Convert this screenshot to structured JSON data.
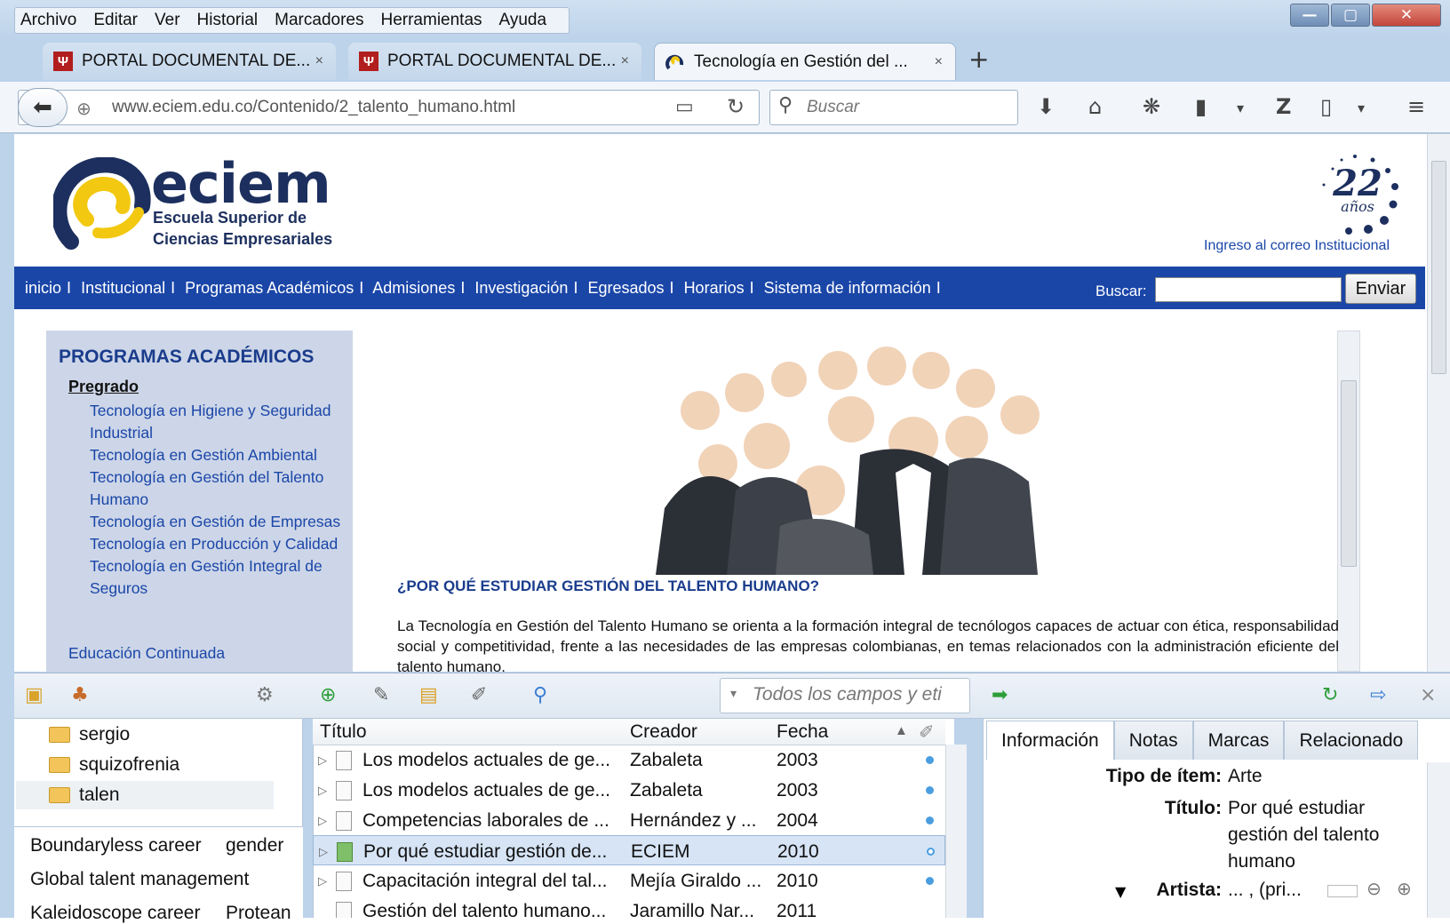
{
  "menubar": {
    "items": [
      "Archivo",
      "Editar",
      "Ver",
      "Historial",
      "Marcadores",
      "Herramientas",
      "Ayuda"
    ]
  },
  "window_buttons": {
    "minimize": "—",
    "maximize": "▢",
    "close": "✕"
  },
  "tabs": [
    {
      "label": "PORTAL DOCUMENTAL DE...",
      "favicon": "Ψ"
    },
    {
      "label": "PORTAL DOCUMENTAL DE...",
      "favicon": "Ψ"
    },
    {
      "label": "Tecnología en Gestión del ...",
      "favicon": "eciem"
    }
  ],
  "tab_close": "×",
  "new_tab": "+",
  "navbar": {
    "url": "www.eciem.edu.co/Contenido/2_talento_humano.html",
    "search_placeholder": "Buscar"
  },
  "site": {
    "logo_name": "eciem",
    "logo_line1": "Escuela  Superior  de",
    "logo_line2": "Ciencias  Empresariales",
    "badge_number": "22",
    "badge_text": "años",
    "correo_link": "Ingreso al correo Institucional",
    "nav": [
      "inicio",
      "Institucional",
      "Programas Académicos",
      "Admisiones",
      "Investigación",
      "Egresados",
      "Horarios",
      "Sistema de información"
    ],
    "nav_sep": "I",
    "search_label": "Buscar:",
    "search_button": "Enviar",
    "sidebar": {
      "heading": "PROGRAMAS ACADÉMICOS",
      "pregrado": "Pregrado",
      "programs": [
        "Tecnología en Higiene y Seguridad Industrial",
        "Tecnología en Gestión Ambiental",
        "Tecnología en Gestión del Talento Humano",
        "Tecnología en Gestión de Empresas",
        "Tecnología en Producción y Calidad",
        "Tecnología en Gestión Integral de Seguros"
      ],
      "continuing": "Educación Continuada"
    },
    "question": "¿POR QUÉ ESTUDIAR GESTIÓN DEL TALENTO HUMANO?",
    "body": "La Tecnología en Gestión del Talento Humano se orienta a la formación integral de tecnólogos capaces de actuar con ética, responsabilidad social y competitividad, frente a las necesidades de las empresas colombianas, en temas relacionados con la administración eficiente del talento humano."
  },
  "zotero": {
    "search_placeholder": "Todos los campos y eti",
    "collections": [
      "sergio",
      "squizofrenia",
      "talen"
    ],
    "tags": [
      [
        "Boundaryless career",
        "gender"
      ],
      [
        "Global talent management"
      ],
      [
        "Kaleidoscope career",
        "Protean"
      ]
    ],
    "columns": {
      "title": "Título",
      "creator": "Creador",
      "date": "Fecha"
    },
    "items": [
      {
        "title": "Los modelos actuales de ge...",
        "creator": "Zabaleta",
        "date": "2003"
      },
      {
        "title": "Los modelos actuales de ge...",
        "creator": "Zabaleta",
        "date": "2003"
      },
      {
        "title": "Competencias laborales de ...",
        "creator": "Hernández y ...",
        "date": "2004"
      },
      {
        "title": "Por qué estudiar gestión de...",
        "creator": "ECIEM",
        "date": "2010"
      },
      {
        "title": "Capacitación integral del tal...",
        "creator": "Mejía Giraldo ...",
        "date": "2010"
      },
      {
        "title": "Gestión del talento humano...",
        "creator": "Jaramillo Nar...",
        "date": "2011"
      }
    ],
    "selected_index": 3,
    "right_tabs": [
      "Información",
      "Notas",
      "Marcas",
      "Relacionado"
    ],
    "info": {
      "type_label": "Tipo de ítem:",
      "type_value": "Arte",
      "title_label": "Título:",
      "title_value": "Por qué estudiar gestión del talento humano",
      "artist_label": "Artista:",
      "artist_value": "... , (pri..."
    }
  },
  "colors": {
    "brand_blue": "#1a46a8",
    "sidebar_bg": "#cdd6e8",
    "logo_yellow": "#f2c811",
    "logo_navy": "#1c2f5e"
  }
}
